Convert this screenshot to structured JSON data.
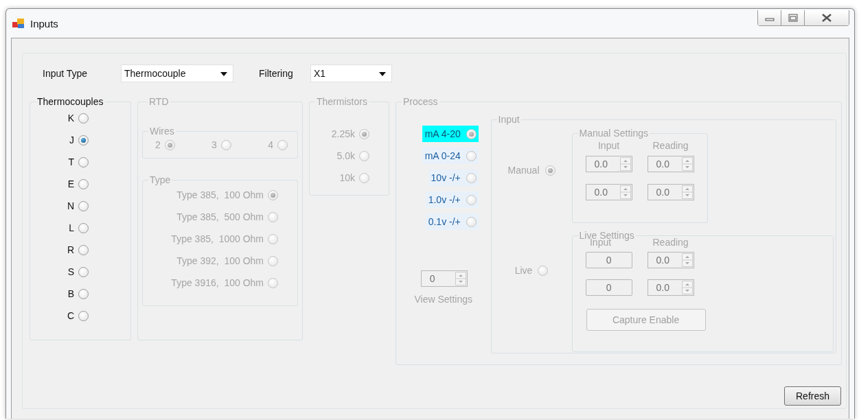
{
  "window": {
    "title": "Inputs"
  },
  "input_type": {
    "label": "Input Type",
    "value": "Thermocouple"
  },
  "filtering": {
    "label": "Filtering",
    "value": "X1"
  },
  "thermocouples": {
    "title": "Thermocouples",
    "disabled": false,
    "options": [
      {
        "label": "K",
        "selected": false
      },
      {
        "label": "J",
        "selected": true
      },
      {
        "label": "T",
        "selected": false
      },
      {
        "label": "E",
        "selected": false
      },
      {
        "label": "N",
        "selected": false
      },
      {
        "label": "L",
        "selected": false
      },
      {
        "label": "R",
        "selected": false
      },
      {
        "label": "S",
        "selected": false
      },
      {
        "label": "B",
        "selected": false
      },
      {
        "label": "C",
        "selected": false
      }
    ]
  },
  "rtd": {
    "title": "RTD",
    "disabled": true,
    "wires": {
      "title": "Wires",
      "options": [
        {
          "label": "2",
          "selected": true
        },
        {
          "label": "3",
          "selected": false
        },
        {
          "label": "4",
          "selected": false
        }
      ]
    },
    "type": {
      "title": "Type",
      "options": [
        {
          "label": "Type 385,  100 Ohm",
          "selected": true
        },
        {
          "label": "Type 385,  500 Ohm",
          "selected": false
        },
        {
          "label": "Type 385,  1000 Ohm",
          "selected": false
        },
        {
          "label": "Type 392,  100 Ohm",
          "selected": false
        },
        {
          "label": "Type 3916,  100 Ohm",
          "selected": false
        }
      ]
    }
  },
  "thermistors": {
    "title": "Thermistors",
    "disabled": true,
    "options": [
      {
        "label": "2.25k",
        "selected": true
      },
      {
        "label": "5.0k",
        "selected": false
      },
      {
        "label": "10k",
        "selected": false
      }
    ]
  },
  "process": {
    "title": "Process",
    "disabled": true,
    "options": [
      {
        "label": "mA 4-20",
        "selected": true
      },
      {
        "label": "mA 0-24",
        "selected": false
      },
      {
        "label": "10v -/+",
        "selected": false
      },
      {
        "label": "1.0v -/+",
        "selected": false
      },
      {
        "label": "0.1v -/+",
        "selected": false
      }
    ],
    "view_settings": {
      "value": "0",
      "label": "View Settings"
    },
    "input": {
      "title": "Input",
      "modes": [
        {
          "label": "Manual",
          "selected": true
        },
        {
          "label": "Live",
          "selected": false
        }
      ],
      "manual_settings": {
        "title": "Manual Settings",
        "columns": [
          "Input",
          "Reading"
        ],
        "rows": [
          [
            "0.0",
            "0.0"
          ],
          [
            "0.0",
            "0.0"
          ]
        ]
      },
      "live_settings": {
        "title": "Live Settings",
        "columns": [
          "Input",
          "Reading"
        ],
        "rows": [
          [
            "0",
            "0.0"
          ],
          [
            "0",
            "0.0"
          ]
        ],
        "capture_button": "Capture Enable"
      }
    }
  },
  "refresh_button": "Refresh"
}
